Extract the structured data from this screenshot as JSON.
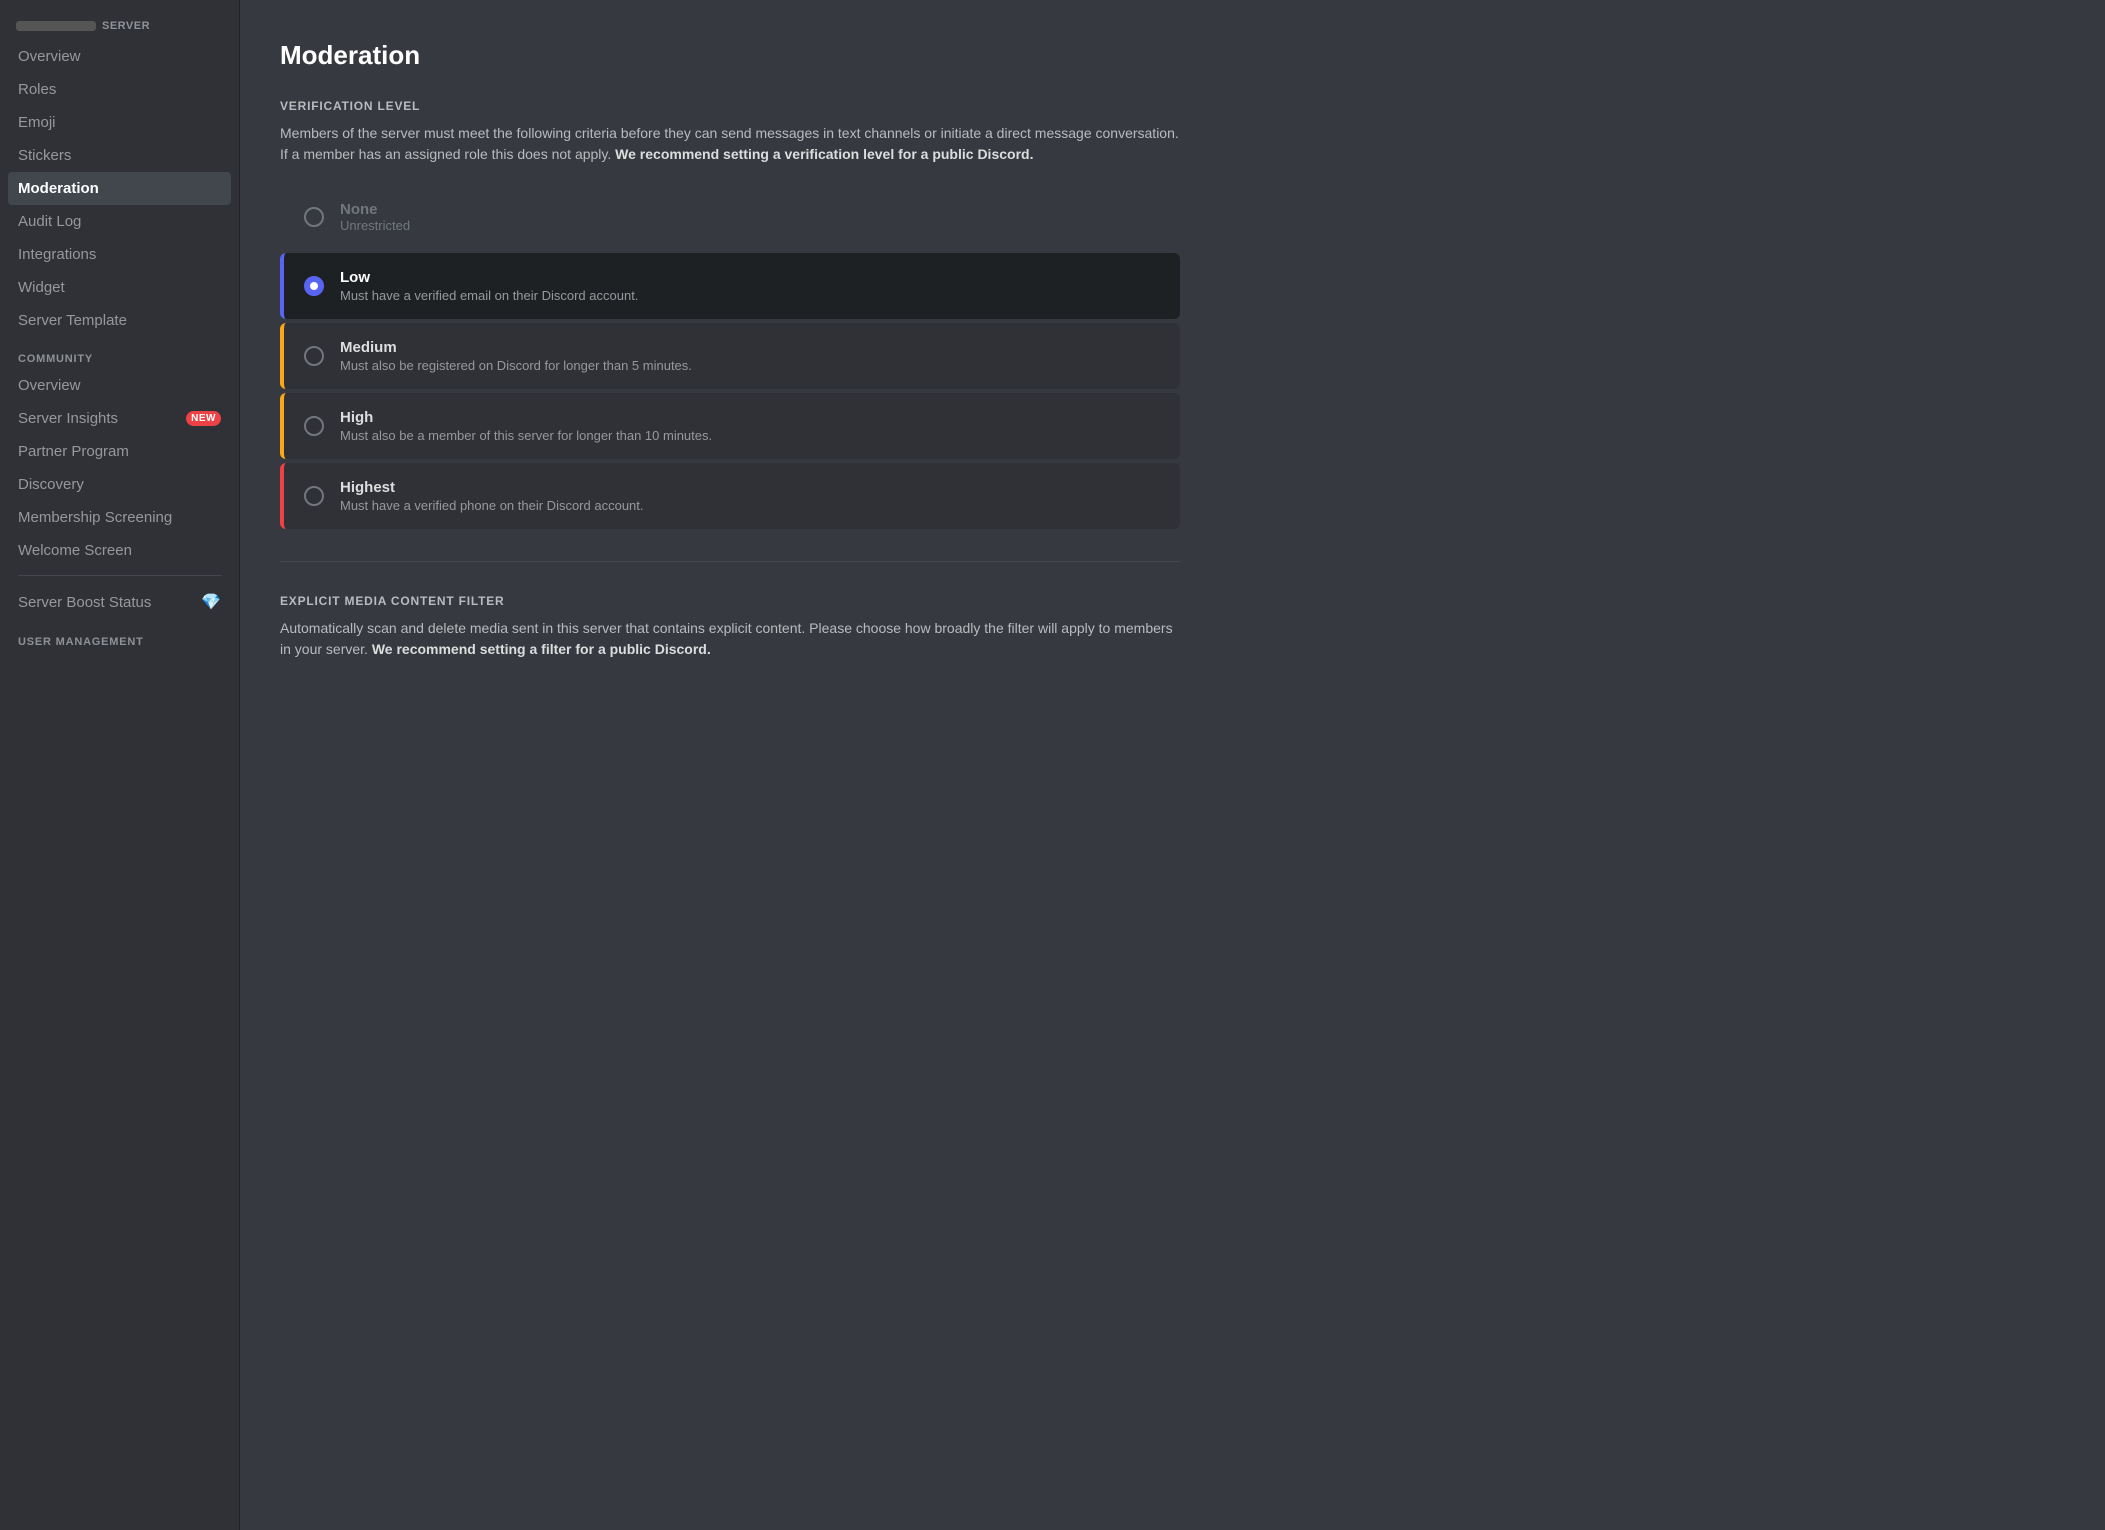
{
  "sidebar": {
    "server_label": "SERVER",
    "items": [
      {
        "id": "overview",
        "label": "Overview",
        "active": false
      },
      {
        "id": "roles",
        "label": "Roles",
        "active": false
      },
      {
        "id": "emoji",
        "label": "Emoji",
        "active": false
      },
      {
        "id": "stickers",
        "label": "Stickers",
        "active": false
      },
      {
        "id": "moderation",
        "label": "Moderation",
        "active": true
      },
      {
        "id": "audit-log",
        "label": "Audit Log",
        "active": false
      },
      {
        "id": "integrations",
        "label": "Integrations",
        "active": false
      },
      {
        "id": "widget",
        "label": "Widget",
        "active": false
      },
      {
        "id": "server-template",
        "label": "Server Template",
        "active": false
      }
    ],
    "community_label": "COMMUNITY",
    "community_items": [
      {
        "id": "community-overview",
        "label": "Overview",
        "active": false,
        "badge": null
      },
      {
        "id": "server-insights",
        "label": "Server Insights",
        "active": false,
        "badge": "NEW"
      },
      {
        "id": "partner-program",
        "label": "Partner Program",
        "active": false,
        "badge": null
      },
      {
        "id": "discovery",
        "label": "Discovery",
        "active": false,
        "badge": null
      },
      {
        "id": "membership-screening",
        "label": "Membership Screening",
        "active": false,
        "badge": null
      },
      {
        "id": "welcome-screen",
        "label": "Welcome Screen",
        "active": false,
        "badge": null
      }
    ],
    "boost_label": "Server Boost Status",
    "user_management_label": "USER MANAGEMENT"
  },
  "main": {
    "title": "Moderation",
    "verification": {
      "section_label": "VERIFICATION LEVEL",
      "description": "Members of the server must meet the following criteria before they can send messages in text channels or initiate a direct message conversation. If a member has an assigned role this does not apply.",
      "description_bold": "We recommend setting a verification level for a public Discord.",
      "options": [
        {
          "id": "none",
          "label": "None",
          "sublabel": "Unrestricted",
          "checked": false,
          "border": "none"
        },
        {
          "id": "low",
          "label": "Low",
          "sublabel": "Must have a verified email on their Discord account.",
          "checked": true,
          "border": "blue"
        },
        {
          "id": "medium",
          "label": "Medium",
          "sublabel": "Must also be registered on Discord for longer than 5 minutes.",
          "checked": false,
          "border": "yellow"
        },
        {
          "id": "high",
          "label": "High",
          "sublabel": "Must also be a member of this server for longer than 10 minutes.",
          "checked": false,
          "border": "yellow"
        },
        {
          "id": "highest",
          "label": "Highest",
          "sublabel": "Must have a verified phone on their Discord account.",
          "checked": false,
          "border": "red"
        }
      ]
    },
    "explicit_filter": {
      "section_label": "EXPLICIT MEDIA CONTENT FILTER",
      "description": "Automatically scan and delete media sent in this server that contains explicit content. Please choose how broadly the filter will apply to members in your server.",
      "description_bold": "We recommend setting a filter for a public Discord."
    }
  }
}
